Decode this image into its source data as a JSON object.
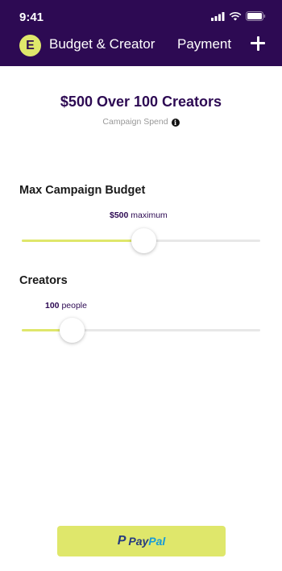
{
  "status_bar": {
    "time": "9:41"
  },
  "nav": {
    "logo_letter": "E",
    "active_step": "Budget & Creator",
    "next_step": "Payment"
  },
  "summary": {
    "title": "$500 Over 100 Creators",
    "subtitle": "Campaign Spend"
  },
  "budget": {
    "label": "Max Campaign Budget",
    "value_text": "$500",
    "value_suffix": "maximum",
    "slider_fraction": 0.51
  },
  "creators": {
    "label": "Creators",
    "value_text": "100",
    "value_suffix": "people",
    "slider_fraction": 0.21
  },
  "payment": {
    "pay": "Pay",
    "pal": "Pal",
    "icon": "paypal-icon"
  },
  "colors": {
    "header_bg": "#2d0a53",
    "accent": "#dfe76b",
    "paypal_dark": "#253b80",
    "paypal_light": "#179bd7"
  }
}
